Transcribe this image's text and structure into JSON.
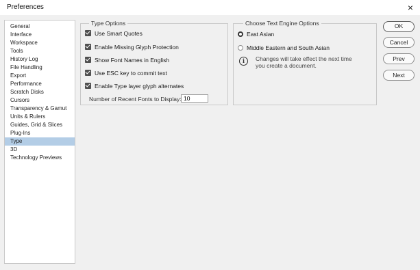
{
  "window": {
    "title": "Preferences",
    "close_glyph": "×"
  },
  "sidebar": {
    "items": [
      {
        "label": "General"
      },
      {
        "label": "Interface"
      },
      {
        "label": "Workspace"
      },
      {
        "label": "Tools"
      },
      {
        "label": "History Log"
      },
      {
        "label": "File Handling"
      },
      {
        "label": "Export"
      },
      {
        "label": "Performance"
      },
      {
        "label": "Scratch Disks"
      },
      {
        "label": "Cursors"
      },
      {
        "label": "Transparency & Gamut"
      },
      {
        "label": "Units & Rulers"
      },
      {
        "label": "Guides, Grid & Slices"
      },
      {
        "label": "Plug-Ins"
      },
      {
        "label": "Type"
      },
      {
        "label": "3D"
      },
      {
        "label": "Technology Previews"
      }
    ],
    "selected": "Type"
  },
  "type_options": {
    "title": "Type Options",
    "checkboxes": [
      {
        "label": "Use Smart Quotes",
        "checked": true
      },
      {
        "label": "Enable Missing Glyph Protection",
        "checked": true
      },
      {
        "label": "Show Font Names in English",
        "checked": true
      },
      {
        "label": "Use ESC key to commit text",
        "checked": true
      },
      {
        "label": "Enable Type layer glyph alternates",
        "checked": true
      }
    ],
    "recent_fonts_label": "Number of Recent Fonts to Display:",
    "recent_fonts_value": "10"
  },
  "text_engine": {
    "title": "Choose Text Engine Options",
    "options": [
      {
        "label": "East Asian",
        "selected": true
      },
      {
        "label": "Middle Eastern and South Asian",
        "selected": false
      }
    ],
    "info_glyph": "i",
    "note_line1": "Changes will take effect the next time",
    "note_line2": "you create a document."
  },
  "buttons": {
    "ok": "OK",
    "cancel": "Cancel",
    "prev": "Prev",
    "next": "Next"
  },
  "colors": {
    "selection": "#b3cde6",
    "checkbox_fill": "#505050",
    "background": "#f0f0f0"
  }
}
